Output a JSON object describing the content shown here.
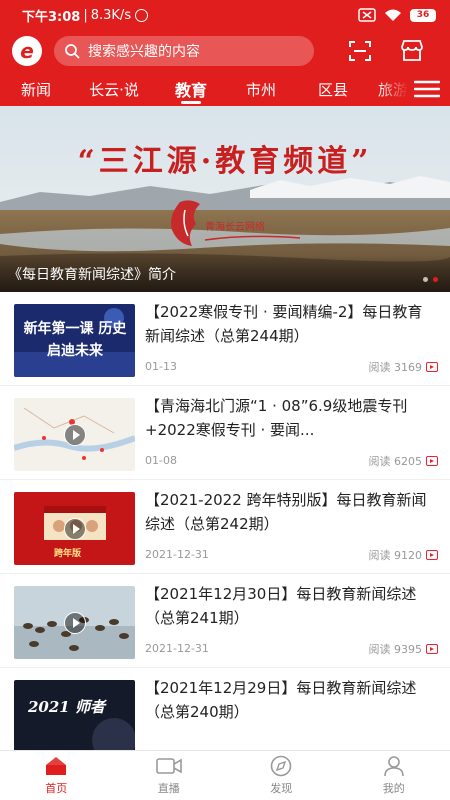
{
  "status": {
    "time": "下午3:08",
    "speed": "8.3K/s",
    "battery": "36"
  },
  "header": {
    "logo": "e",
    "search_placeholder": "搜索感兴趣的内容",
    "icons": [
      "scan-icon",
      "store-icon"
    ]
  },
  "tabs": [
    {
      "label": "新闻",
      "active": false
    },
    {
      "label": "长云·说",
      "active": false
    },
    {
      "label": "教育",
      "active": true
    },
    {
      "label": "市州",
      "active": false
    },
    {
      "label": "区县",
      "active": false
    },
    {
      "label": "旅游",
      "active": false
    }
  ],
  "banner": {
    "headline": "“三江源·教育频道”",
    "stamp": "青海长云网络",
    "caption": "《每日教育新闻综述》简介",
    "slide_count": 2,
    "active_slide": 2
  },
  "articles": [
    {
      "title": "【2022寒假专刊 · 要闻精编-2】每日教育新闻综述（总第244期）",
      "date": "01-13",
      "reads": "阅读 3169",
      "thumb_text": "新年第一课 历史启迪未来",
      "thumb_style": "navy",
      "video": false
    },
    {
      "title": "【青海海北门源“1 · 08”6.9级地震专刊+2022寒假专刊 · 要闻...",
      "date": "01-08",
      "reads": "阅读 6205",
      "thumb_text": "",
      "thumb_style": "map",
      "video": true
    },
    {
      "title": "【2021-2022 跨年特别版】每日教育新闻综述（总第242期）",
      "date": "2021-12-31",
      "reads": "阅读 9120",
      "thumb_text": "跨年版",
      "thumb_style": "red",
      "video": true
    },
    {
      "title": "【2021年12月30日】每日教育新闻综述（总第241期）",
      "date": "2021-12-31",
      "reads": "阅读 9395",
      "thumb_text": "",
      "thumb_style": "birds",
      "video": true
    },
    {
      "title": "【2021年12月29日】每日教育新闻综述（总第240期）",
      "date": "",
      "reads": "",
      "thumb_text": "2021 师者",
      "thumb_style": "dark",
      "video": false
    }
  ],
  "bottom_nav": [
    {
      "label": "首页",
      "icon": "home-icon",
      "active": true
    },
    {
      "label": "直播",
      "icon": "live-icon",
      "active": false
    },
    {
      "label": "发现",
      "icon": "compass-icon",
      "active": false
    },
    {
      "label": "我的",
      "icon": "profile-icon",
      "active": false
    }
  ],
  "colors": {
    "brand": "#e01e1e",
    "text": "#222222",
    "muted": "#999999"
  }
}
